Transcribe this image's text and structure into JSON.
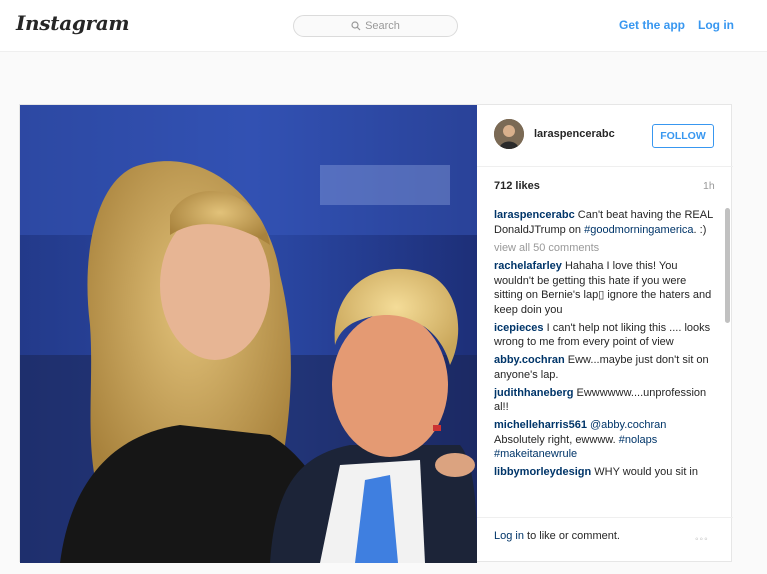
{
  "header": {
    "logo": "Instagram",
    "search_placeholder": "Search",
    "get_app": "Get the app",
    "login": "Log in"
  },
  "post": {
    "username": "laraspencerabc",
    "follow_label": "FOLLOW",
    "likes": "712 likes",
    "time": "1h",
    "caption_user": "laraspencerabc",
    "caption_text": "Can't beat having the REAL DonaldJTrump on ",
    "caption_tag": "#goodmorningamerica",
    "caption_end": ". :)",
    "view_all": "view all 50 comments",
    "comments": [
      {
        "user": "rachelafarley",
        "text": "Hahaha I love this! You wouldn't be getting this hate if you were sitting on Bernie's lap▯ ignore the haters and keep doin you"
      },
      {
        "user": "icepieces",
        "text": "I can't help not liking this .... looks wrong to me from every point of view"
      },
      {
        "user": "abby.cochran",
        "text": "Eww...maybe just don't sit on anyone's lap."
      },
      {
        "user": "judithhaneberg",
        "text": "Ewwwwww....unprofession al!!"
      },
      {
        "user": "michelleharris561",
        "mention": "@abby.cochran",
        "text": " Absolutely right, ewwww. ",
        "tag1": "#nolaps",
        "tag2": "#makeitanewrule"
      },
      {
        "user": "libbymorleydesign",
        "text": "WHY would you sit in"
      }
    ],
    "footer_login": "Log in",
    "footer_text": " to like or comment.",
    "more": "◦◦◦"
  }
}
